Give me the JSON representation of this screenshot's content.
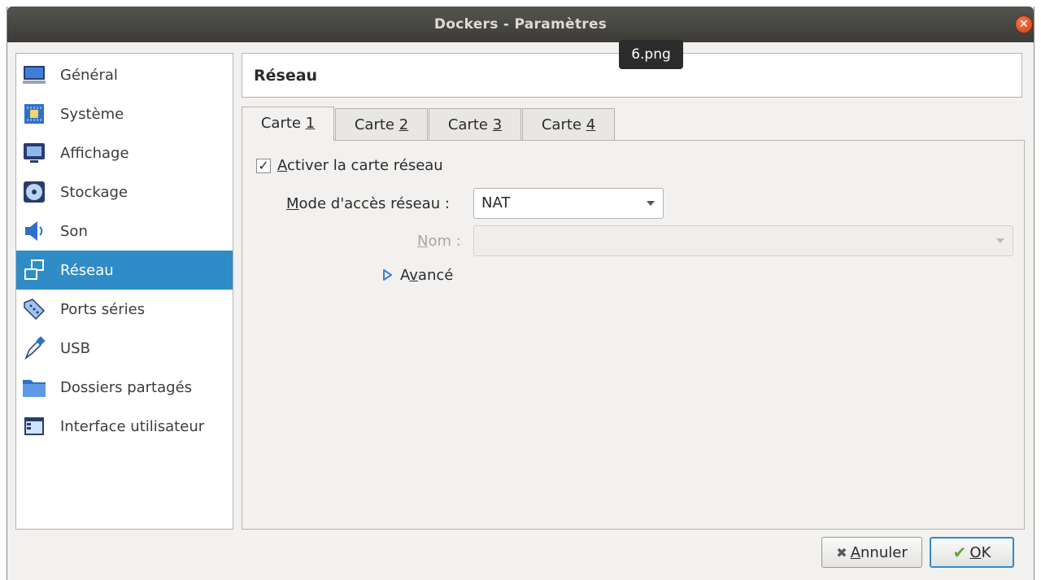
{
  "window": {
    "title": "Dockers - Paramètres",
    "close_glyph": "✕"
  },
  "tooltip": {
    "text": "6.png"
  },
  "sidebar": {
    "items": [
      {
        "label": "Général",
        "icon": "monitor-icon"
      },
      {
        "label": "Système",
        "icon": "chip-icon"
      },
      {
        "label": "Affichage",
        "icon": "display-icon"
      },
      {
        "label": "Stockage",
        "icon": "disk-icon"
      },
      {
        "label": "Son",
        "icon": "speaker-icon"
      },
      {
        "label": "Réseau",
        "icon": "network-icon",
        "selected": true
      },
      {
        "label": "Ports séries",
        "icon": "serial-port-icon"
      },
      {
        "label": "USB",
        "icon": "usb-icon"
      },
      {
        "label": "Dossiers partagés",
        "icon": "folder-icon"
      },
      {
        "label": "Interface utilisateur",
        "icon": "ui-window-icon"
      }
    ]
  },
  "main": {
    "header": "Réseau",
    "tabs": [
      {
        "prefix": "Carte ",
        "mnemonic": "1"
      },
      {
        "prefix": "Carte ",
        "mnemonic": "2"
      },
      {
        "prefix": "Carte ",
        "mnemonic": "3"
      },
      {
        "prefix": "Carte ",
        "mnemonic": "4"
      }
    ],
    "enable_checkbox": {
      "mnemonic": "A",
      "rest": "ctiver la carte réseau",
      "checked_glyph": "✓"
    },
    "mode": {
      "mnemonic": "M",
      "rest": "ode d'accès réseau :",
      "value": "NAT"
    },
    "name": {
      "mnemonic": "N",
      "rest": "om :",
      "value": ""
    },
    "advanced": {
      "prefix": "A",
      "mnemonic": "v",
      "rest": "ancé"
    }
  },
  "buttons": {
    "cancel": {
      "glyph": "✖",
      "mnemonic": "A",
      "rest": "nnuler"
    },
    "ok": {
      "glyph": "✔",
      "mnemonic": "O",
      "rest": "K"
    }
  },
  "colors": {
    "selection": "#308cc6",
    "titlebar": "#3c3b37",
    "close": "#e05a2b"
  }
}
